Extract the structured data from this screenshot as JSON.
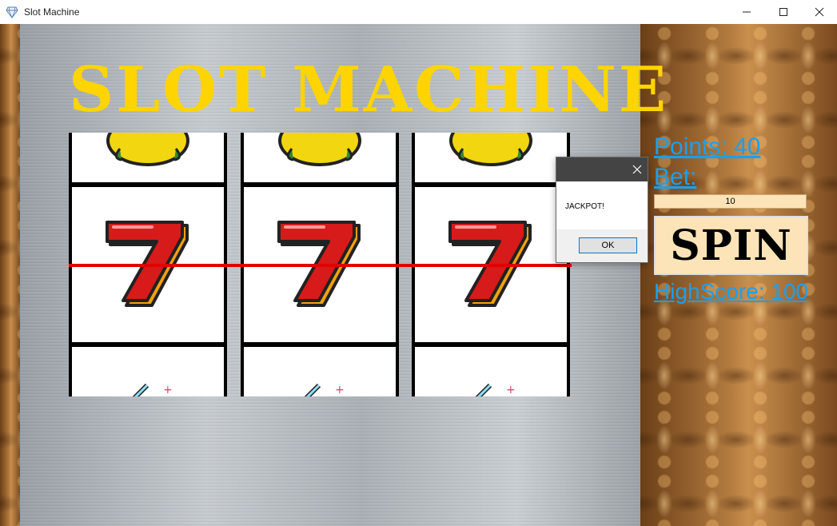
{
  "window": {
    "title": "Slot Machine",
    "icon": "diamond-icon",
    "controls": [
      "minimize-icon",
      "maximize-icon",
      "close-icon"
    ]
  },
  "game": {
    "title": "SLOT MACHINE",
    "reels": [
      {
        "top": "lemon",
        "middle": "seven",
        "bottom": "four"
      },
      {
        "top": "lemon",
        "middle": "seven",
        "bottom": "four"
      },
      {
        "top": "lemon",
        "middle": "seven",
        "bottom": "four"
      }
    ]
  },
  "panel": {
    "points_label": "Points: 40",
    "bet_label": "Bet:",
    "bet_value": "10",
    "spin_label": "SPIN",
    "highscore_label": "HighScore: 100"
  },
  "dialog": {
    "message": "JACKPOT!",
    "ok_label": "OK"
  },
  "colors": {
    "title_yellow": "#ffd400",
    "label_blue": "#1aa0f0",
    "payline_red": "#e00000",
    "button_bg": "#fde4b8",
    "dialog_titlebar": "#444444"
  }
}
